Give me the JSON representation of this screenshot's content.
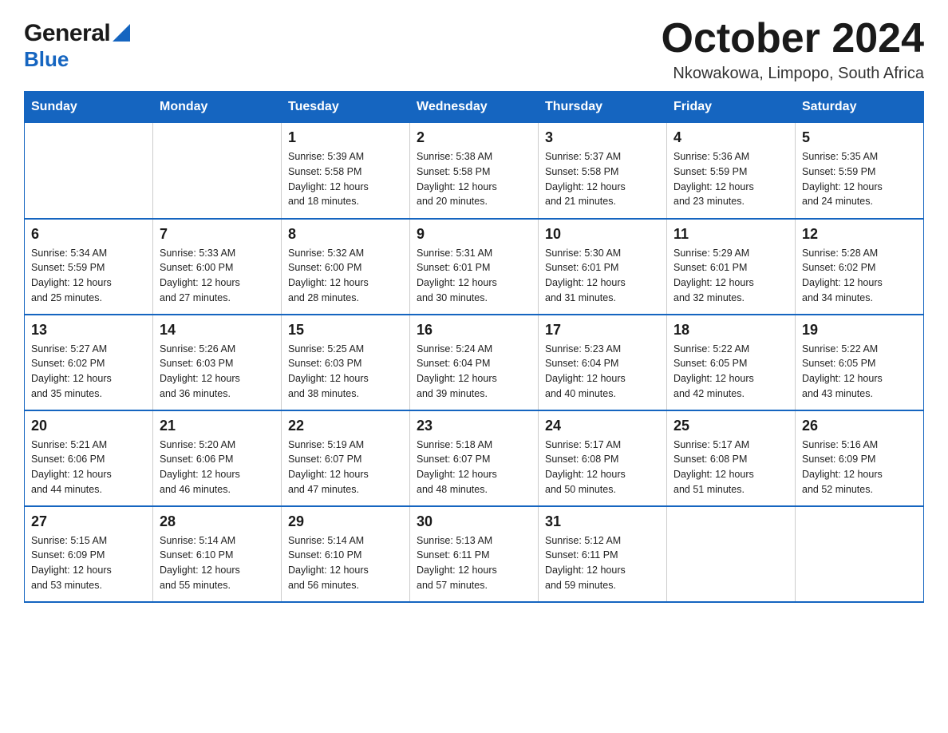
{
  "header": {
    "logo_general": "General",
    "logo_blue": "Blue",
    "title": "October 2024",
    "location": "Nkowakowa, Limpopo, South Africa"
  },
  "columns": [
    "Sunday",
    "Monday",
    "Tuesday",
    "Wednesday",
    "Thursday",
    "Friday",
    "Saturday"
  ],
  "weeks": [
    {
      "days": [
        {
          "num": "",
          "info": ""
        },
        {
          "num": "",
          "info": ""
        },
        {
          "num": "1",
          "info": "Sunrise: 5:39 AM\nSunset: 5:58 PM\nDaylight: 12 hours\nand 18 minutes."
        },
        {
          "num": "2",
          "info": "Sunrise: 5:38 AM\nSunset: 5:58 PM\nDaylight: 12 hours\nand 20 minutes."
        },
        {
          "num": "3",
          "info": "Sunrise: 5:37 AM\nSunset: 5:58 PM\nDaylight: 12 hours\nand 21 minutes."
        },
        {
          "num": "4",
          "info": "Sunrise: 5:36 AM\nSunset: 5:59 PM\nDaylight: 12 hours\nand 23 minutes."
        },
        {
          "num": "5",
          "info": "Sunrise: 5:35 AM\nSunset: 5:59 PM\nDaylight: 12 hours\nand 24 minutes."
        }
      ]
    },
    {
      "days": [
        {
          "num": "6",
          "info": "Sunrise: 5:34 AM\nSunset: 5:59 PM\nDaylight: 12 hours\nand 25 minutes."
        },
        {
          "num": "7",
          "info": "Sunrise: 5:33 AM\nSunset: 6:00 PM\nDaylight: 12 hours\nand 27 minutes."
        },
        {
          "num": "8",
          "info": "Sunrise: 5:32 AM\nSunset: 6:00 PM\nDaylight: 12 hours\nand 28 minutes."
        },
        {
          "num": "9",
          "info": "Sunrise: 5:31 AM\nSunset: 6:01 PM\nDaylight: 12 hours\nand 30 minutes."
        },
        {
          "num": "10",
          "info": "Sunrise: 5:30 AM\nSunset: 6:01 PM\nDaylight: 12 hours\nand 31 minutes."
        },
        {
          "num": "11",
          "info": "Sunrise: 5:29 AM\nSunset: 6:01 PM\nDaylight: 12 hours\nand 32 minutes."
        },
        {
          "num": "12",
          "info": "Sunrise: 5:28 AM\nSunset: 6:02 PM\nDaylight: 12 hours\nand 34 minutes."
        }
      ]
    },
    {
      "days": [
        {
          "num": "13",
          "info": "Sunrise: 5:27 AM\nSunset: 6:02 PM\nDaylight: 12 hours\nand 35 minutes."
        },
        {
          "num": "14",
          "info": "Sunrise: 5:26 AM\nSunset: 6:03 PM\nDaylight: 12 hours\nand 36 minutes."
        },
        {
          "num": "15",
          "info": "Sunrise: 5:25 AM\nSunset: 6:03 PM\nDaylight: 12 hours\nand 38 minutes."
        },
        {
          "num": "16",
          "info": "Sunrise: 5:24 AM\nSunset: 6:04 PM\nDaylight: 12 hours\nand 39 minutes."
        },
        {
          "num": "17",
          "info": "Sunrise: 5:23 AM\nSunset: 6:04 PM\nDaylight: 12 hours\nand 40 minutes."
        },
        {
          "num": "18",
          "info": "Sunrise: 5:22 AM\nSunset: 6:05 PM\nDaylight: 12 hours\nand 42 minutes."
        },
        {
          "num": "19",
          "info": "Sunrise: 5:22 AM\nSunset: 6:05 PM\nDaylight: 12 hours\nand 43 minutes."
        }
      ]
    },
    {
      "days": [
        {
          "num": "20",
          "info": "Sunrise: 5:21 AM\nSunset: 6:06 PM\nDaylight: 12 hours\nand 44 minutes."
        },
        {
          "num": "21",
          "info": "Sunrise: 5:20 AM\nSunset: 6:06 PM\nDaylight: 12 hours\nand 46 minutes."
        },
        {
          "num": "22",
          "info": "Sunrise: 5:19 AM\nSunset: 6:07 PM\nDaylight: 12 hours\nand 47 minutes."
        },
        {
          "num": "23",
          "info": "Sunrise: 5:18 AM\nSunset: 6:07 PM\nDaylight: 12 hours\nand 48 minutes."
        },
        {
          "num": "24",
          "info": "Sunrise: 5:17 AM\nSunset: 6:08 PM\nDaylight: 12 hours\nand 50 minutes."
        },
        {
          "num": "25",
          "info": "Sunrise: 5:17 AM\nSunset: 6:08 PM\nDaylight: 12 hours\nand 51 minutes."
        },
        {
          "num": "26",
          "info": "Sunrise: 5:16 AM\nSunset: 6:09 PM\nDaylight: 12 hours\nand 52 minutes."
        }
      ]
    },
    {
      "days": [
        {
          "num": "27",
          "info": "Sunrise: 5:15 AM\nSunset: 6:09 PM\nDaylight: 12 hours\nand 53 minutes."
        },
        {
          "num": "28",
          "info": "Sunrise: 5:14 AM\nSunset: 6:10 PM\nDaylight: 12 hours\nand 55 minutes."
        },
        {
          "num": "29",
          "info": "Sunrise: 5:14 AM\nSunset: 6:10 PM\nDaylight: 12 hours\nand 56 minutes."
        },
        {
          "num": "30",
          "info": "Sunrise: 5:13 AM\nSunset: 6:11 PM\nDaylight: 12 hours\nand 57 minutes."
        },
        {
          "num": "31",
          "info": "Sunrise: 5:12 AM\nSunset: 6:11 PM\nDaylight: 12 hours\nand 59 minutes."
        },
        {
          "num": "",
          "info": ""
        },
        {
          "num": "",
          "info": ""
        }
      ]
    }
  ]
}
